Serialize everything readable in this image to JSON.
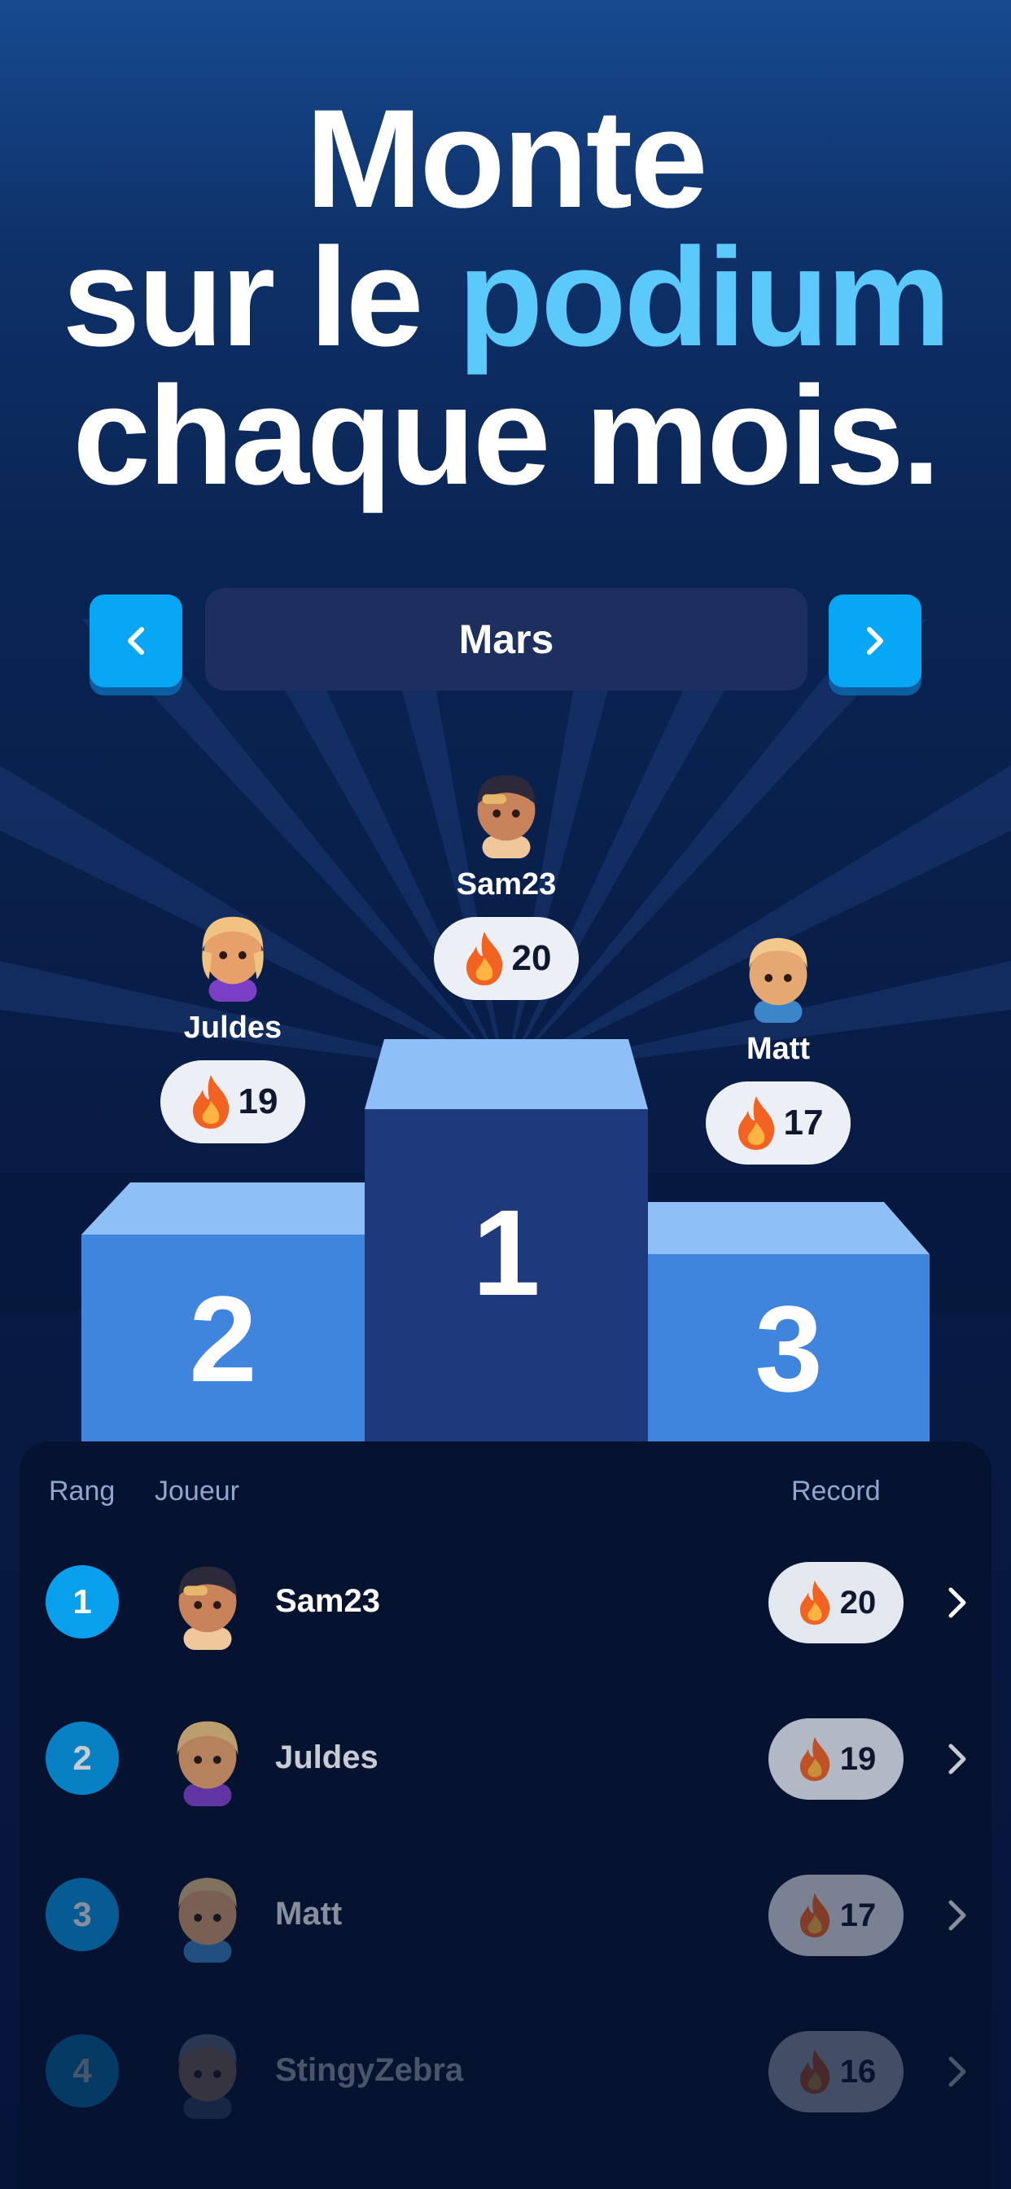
{
  "headline": {
    "line1": "Monte",
    "line2_pre": "sur le ",
    "line2_highlight": "podium",
    "line3": "chaque mois."
  },
  "month": {
    "label": "Mars",
    "prev_icon": "chevron-left-icon",
    "next_icon": "chevron-right-icon"
  },
  "podium": {
    "first": {
      "rank": "1",
      "name": "Sam23",
      "score": "20"
    },
    "second": {
      "rank": "2",
      "name": "Juldes",
      "score": "19"
    },
    "third": {
      "rank": "3",
      "name": "Matt",
      "score": "17"
    }
  },
  "table": {
    "headers": {
      "rank": "Rang",
      "player": "Joueur",
      "record": "Record"
    },
    "rows": [
      {
        "rank": "1",
        "name": "Sam23",
        "score": "20"
      },
      {
        "rank": "2",
        "name": "Juldes",
        "score": "19"
      },
      {
        "rank": "3",
        "name": "Matt",
        "score": "17"
      },
      {
        "rank": "4",
        "name": "StingyZebra",
        "score": "16"
      }
    ]
  },
  "colors": {
    "accent": "#08a7f5",
    "highlight": "#5cc9fb",
    "podium_side": "#3f84dd",
    "podium_center": "#1f3a7c",
    "podium_top": "#8fbff7"
  }
}
